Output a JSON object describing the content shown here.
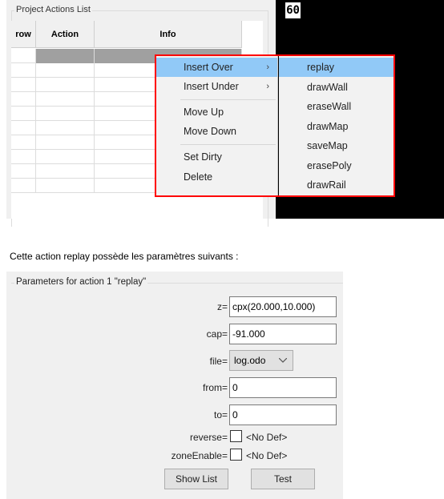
{
  "top_screenshot": {
    "counter": "60",
    "group_title": "Project Actions List",
    "table": {
      "columns": [
        "row",
        "Action",
        "Info"
      ]
    },
    "context_menu": {
      "items": [
        {
          "label": "Insert Over",
          "has_submenu": true,
          "highlighted": true
        },
        {
          "label": "Insert Under",
          "has_submenu": true
        },
        {
          "label": "Move Up"
        },
        {
          "label": "Move Down"
        },
        {
          "label": "Set Dirty"
        },
        {
          "label": "Delete"
        }
      ],
      "submenu": [
        "replay",
        "drawWall",
        "eraseWall",
        "drawMap",
        "saveMap",
        "erasePoly",
        "drawRail"
      ],
      "submenu_highlighted": "replay",
      "arrow_glyph": "›"
    },
    "highlight_color": "#91c9f7",
    "annotation_color": "#ff0000"
  },
  "caption": "Cette action replay possède les paramètres suivants :",
  "parameters": {
    "group_title": "Parameters for action 1 \"replay\"",
    "z_label": "z=",
    "z_value": "cpx(20.000,10.000)",
    "cap_label": "cap=",
    "cap_value": "-91.000",
    "file_label": "file=",
    "file_value": "log.odo",
    "from_label": "from=",
    "from_value": "0",
    "to_label": "to=",
    "to_value": "0",
    "reverse_label": "reverse=",
    "reverse_default": "<No Def>",
    "zoneEnable_label": "zoneEnable=",
    "zoneEnable_default": "<No Def>",
    "show_list_label": "Show List",
    "test_label": "Test"
  }
}
